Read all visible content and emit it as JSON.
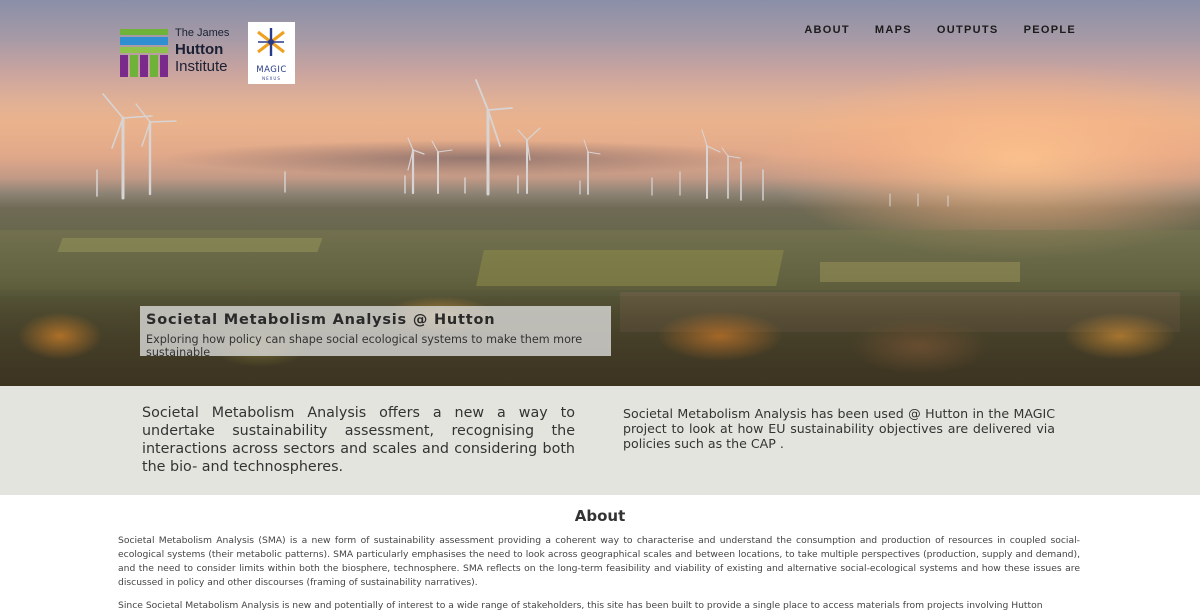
{
  "header": {
    "hutton_logo": {
      "line1": "The James",
      "line2": "Hutton",
      "line3": "Institute"
    },
    "magic_logo": {
      "word": "MAGIC",
      "sub": "NEXUS"
    },
    "nav": [
      "ABOUT",
      "MAPS",
      "OUTPUTS",
      "PEOPLE"
    ]
  },
  "hero": {
    "title": "Societal Metabolism Analysis @ Hutton",
    "subtitle": "Exploring how policy can shape social ecological systems to make them more sustainable"
  },
  "intro": {
    "left": "Societal Metabolism Analysis offers a new a way to undertake sustainability assessment, recognising the interactions across sectors and scales and considering both the bio- and technospheres.",
    "right": "Societal Metabolism Analysis has been used @ Hutton in the MAGIC project to look at how EU sustainability objectives are delivered via policies such as the CAP ."
  },
  "about": {
    "title": "About",
    "p1": "Societal Metabolism Analysis (SMA) is a new form of sustainability assessment providing a coherent way to characterise and understand the consumption and production of resources in coupled social-ecological systems (their metabolic patterns). SMA particularly emphasises the need to look across geographical scales and between locations, to take multiple perspectives (production, supply and demand), and the need to consider limits within both the biosphere, technosphere. SMA reflects on the long-term feasibility and viability of existing and alternative social-ecological systems and how these issues are discussed in policy and other discourses (framing of sustainability narratives).",
    "p2": "Since Societal Metabolism Analysis is new and potentially of interest to a wide range of stakeholders, this site has been built to provide a single place to access materials from projects involving Hutton researchers."
  },
  "colors": {
    "band_bg": "#e4e4de",
    "nav_text": "#1b1b1b",
    "hutton_green": "#6fb23a",
    "hutton_purple": "#7a2a8a",
    "magic_blue": "#2a3a8a",
    "magic_orange": "#f0a020"
  }
}
